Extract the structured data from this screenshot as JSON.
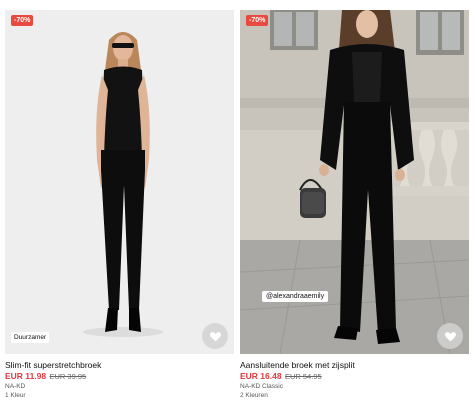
{
  "products": [
    {
      "badge": "-70%",
      "chip": "Duurzamer",
      "title": "Slim-fit superstretchbroek",
      "price_now": "EUR 11.98",
      "price_old": "EUR 39.95",
      "brand": "NA-KD",
      "colors": "1 Kleur"
    },
    {
      "badge": "-70%",
      "chip": "@alexandraaemily",
      "title": "Aansluitende broek met zijsplit",
      "price_now": "EUR 16.48",
      "price_old": "EUR 54.95",
      "brand": "NA-KD Classic",
      "colors": "2 Kleuren"
    }
  ],
  "colors": {
    "badge": "#e94a3f",
    "sale_price": "#e0393e"
  },
  "icons": {
    "wishlist": "heart-icon"
  }
}
